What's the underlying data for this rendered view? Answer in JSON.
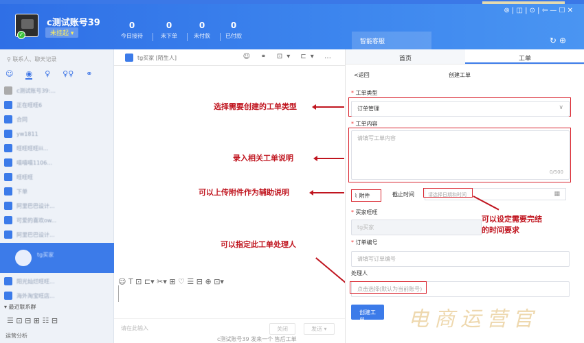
{
  "account": {
    "name": "c测试账号39",
    "status": "未挂起 ▾"
  },
  "stats": [
    {
      "num": "0",
      "label": "今日接待"
    },
    {
      "num": "0",
      "label": "未下单"
    },
    {
      "num": "0",
      "label": "未付款"
    },
    {
      "num": "0",
      "label": "已付款"
    }
  ],
  "header": {
    "smart_tab": "智能客服",
    "window_controls": "⊚ | ◫ | ⊙ | ⇦  —  ☐  ✕",
    "refresh": "↻⊕"
  },
  "sidebar": {
    "search_placeholder": "联系人、聊天记录",
    "icons": [
      "☺",
      "◉",
      "♀",
      "♀♀",
      "⚭"
    ],
    "contacts": [
      "c测试账号39:...",
      "正在旺旺6",
      "合同",
      "yw1811",
      "旺旺旺旺iii...",
      "嘻嘻嘻1106...",
      "旺旺旺",
      "下单",
      "阿里巴巴设计...",
      "可爱的喜欢ow...",
      "阿里巴巴设计...",
      "阳光灿烂旺旺...",
      "海外淘宝旺店..."
    ],
    "active_contact": "tg买家",
    "recent_label": "▾ 最近联系群",
    "bottom_icons": "☰  ⊡  ⊟  ⊞  ☷  ⊟",
    "bottom_text": "运营分析"
  },
  "chat": {
    "contact_name": "tg买家 [陌生人]",
    "tools": "☺ ⚭ ⊡▾ ⊏▾ …",
    "toolbar": "☺  T  ⊡  ⊏▾  ✂▾  ⊞  ♡  ☰  ⊟     ⊕  ⊡▾",
    "input_hint": "请在此输入",
    "btn_close": "关闭",
    "btn_send": "发送 ▾",
    "footer": "c测试账号39 发来一个 售后工单"
  },
  "annotations": {
    "type": "选择需要创建的工单类型",
    "content": "录入相关工单说明",
    "attach": "可以上传附件作为辅助说明",
    "handler": "可以指定此工单处理人",
    "deadline": "可以设定需要完结的时间要求"
  },
  "panel": {
    "tab_home": "首页",
    "tab_ticket": "工单",
    "back": "<返回",
    "title": "创建工单",
    "type_label": "工单类型",
    "type_value": "订单管理",
    "content_label": "工单内容",
    "content_placeholder": "请填写工单内容",
    "content_count": "0/500",
    "attach_label": "附件",
    "deadline_label": "截止时间",
    "deadline_placeholder": "请选择日期和时间",
    "buyer_label": "买家旺旺",
    "buyer_value": "tg买家",
    "order_label": "订单编号",
    "order_placeholder": "请填写订单编号",
    "handler_label": "处理人",
    "handler_placeholder": "点击选择(默认为当前账号)",
    "create_btn": "创建工单",
    "watermark": "电商运营官"
  }
}
